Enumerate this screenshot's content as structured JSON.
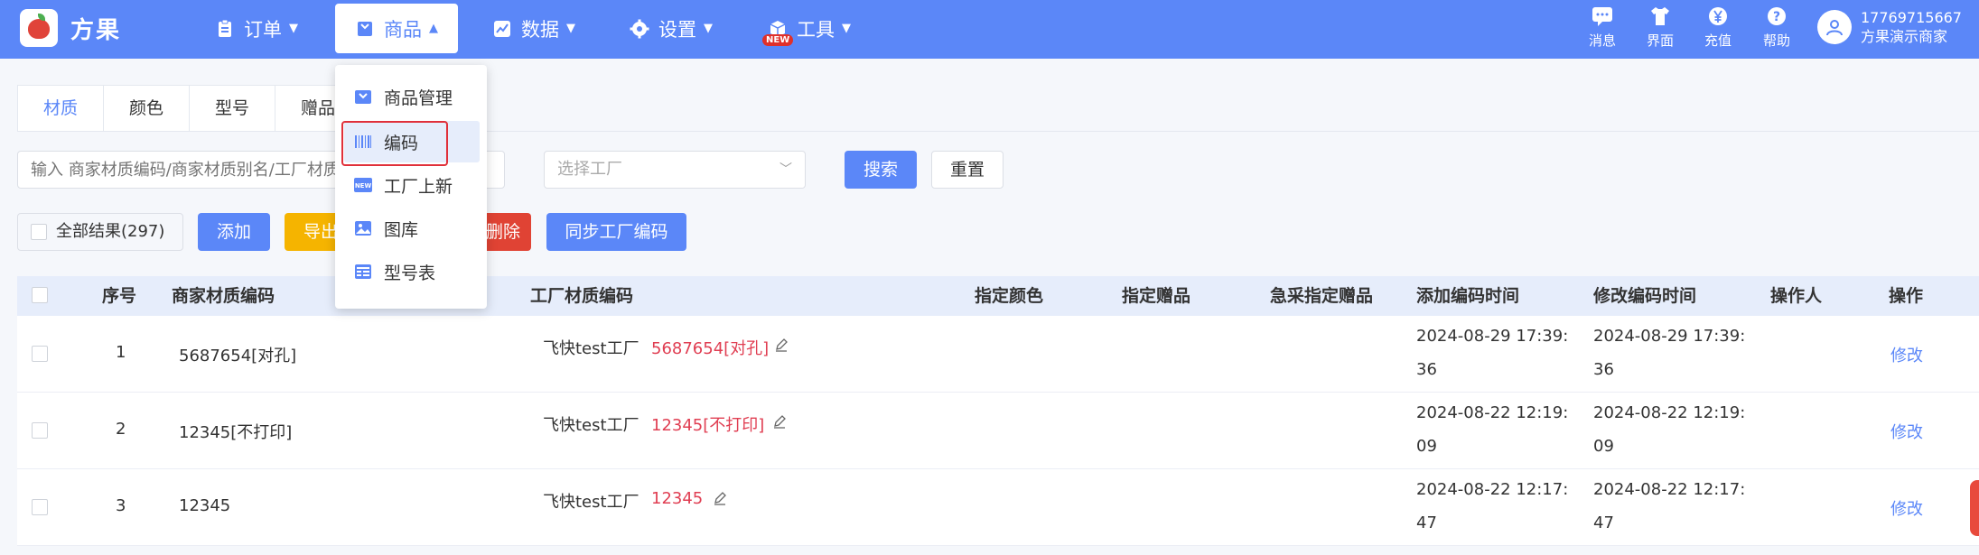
{
  "brand": {
    "name": "方果"
  },
  "nav": {
    "items": [
      {
        "label": "订单"
      },
      {
        "label": "商品"
      },
      {
        "label": "数据"
      },
      {
        "label": "设置"
      },
      {
        "label": "工具",
        "badge": "NEW"
      }
    ]
  },
  "toolbar_right": [
    {
      "label": "消息",
      "icon": "message-icon"
    },
    {
      "label": "界面",
      "icon": "shirt-icon"
    },
    {
      "label": "充值",
      "icon": "yen-icon"
    },
    {
      "label": "帮助",
      "icon": "help-icon"
    }
  ],
  "user": {
    "phone": "17769715667",
    "shop": "方果演示商家"
  },
  "dropdown": {
    "items": [
      {
        "label": "商品管理",
        "icon": "box-icon"
      },
      {
        "label": "编码",
        "icon": "barcode-icon"
      },
      {
        "label": "工厂上新",
        "icon": "new-icon"
      },
      {
        "label": "图库",
        "icon": "image-icon"
      },
      {
        "label": "型号表",
        "icon": "table-icon"
      }
    ]
  },
  "subtabs": [
    {
      "label": "材质"
    },
    {
      "label": "颜色"
    },
    {
      "label": "型号"
    },
    {
      "label": "赠品"
    }
  ],
  "filters": {
    "search_placeholder": "输入 商家材质编码/商家材质别名/工厂材质编码",
    "factory_placeholder": "选择工厂",
    "search_label": "搜索",
    "reset_label": "重置"
  },
  "actions": {
    "all_results": "全部结果(297)",
    "add_label": "添加",
    "export_label": "导出",
    "delete_label": "删除",
    "sync_label": "同步工厂编码"
  },
  "table": {
    "headers": {
      "index": "序号",
      "merchant_code": "商家材质编码",
      "factory_code": "工厂材质编码",
      "color": "指定颜色",
      "gift": "指定赠品",
      "urgent_gift": "急采指定赠品",
      "created": "添加编码时间",
      "modified": "修改编码时间",
      "operator": "操作人",
      "action": "操作"
    },
    "rows": [
      {
        "index": "1",
        "merchant_code": "5687654[对孔]",
        "factory": "飞快test工厂",
        "factory_code": "5687654[对孔]",
        "created_a": "2024-08-29 17:39:",
        "created_b": "36",
        "modified_a": "2024-08-29 17:39:",
        "modified_b": "36",
        "action": "修改"
      },
      {
        "index": "2",
        "merchant_code": "12345[不打印]",
        "factory": "飞快test工厂",
        "factory_code": "12345[不打印]",
        "created_a": "2024-08-22 12:19:",
        "created_b": "09",
        "modified_a": "2024-08-22 12:19:",
        "modified_b": "09",
        "action": "修改"
      },
      {
        "index": "3",
        "merchant_code": "12345",
        "factory": "飞快test工厂",
        "factory_code": "12345",
        "created_a": "2024-08-22 12:17:",
        "created_b": "47",
        "modified_a": "2024-08-22 12:17:",
        "modified_b": "47",
        "action": "修改"
      }
    ]
  },
  "colors": {
    "primary": "#5b87f8",
    "warning": "#f5b400",
    "danger": "#e04334",
    "code_red": "#e03e52"
  }
}
